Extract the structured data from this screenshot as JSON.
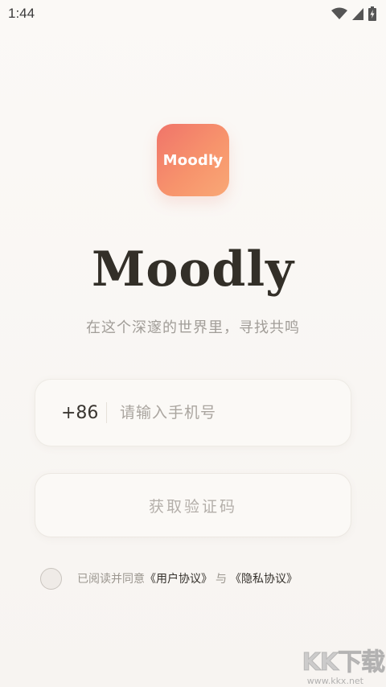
{
  "status_bar": {
    "time": "1:44",
    "icons": [
      "wifi-icon",
      "signal-icon",
      "battery-charging-icon"
    ]
  },
  "app": {
    "icon_label": "Moodly",
    "title": "Moodly",
    "tagline": "在这个深邃的世界里，寻找共鸣",
    "accent_gradient": [
      "#f0746a",
      "#f9a876"
    ]
  },
  "login": {
    "country_code": "+86",
    "phone_placeholder": "请输入手机号",
    "phone_value": "",
    "get_code_label": "获取验证码"
  },
  "agreement": {
    "checked": false,
    "prefix": "已阅读并同意",
    "user_agreement": "《用户协议》",
    "conjunction": "与",
    "privacy_policy": "《隐私协议》"
  },
  "watermark": {
    "logo": "KK下载",
    "url": "www.kkx.net"
  }
}
